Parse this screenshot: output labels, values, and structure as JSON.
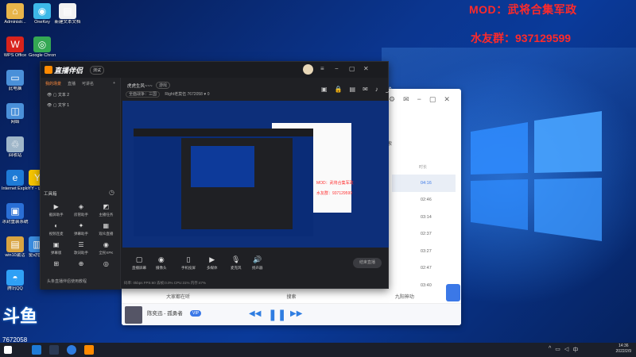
{
  "desktop": {
    "icons": [
      {
        "label": "Administr...",
        "color": "#e8b54a",
        "glyph": "⌂"
      },
      {
        "label": "OneKey",
        "color": "#3db8e8",
        "glyph": "◉"
      },
      {
        "label": "新建文本文档",
        "color": "#f2f2f2",
        "glyph": "▤"
      },
      {
        "label": "WPS Office",
        "color": "#d8231c",
        "glyph": "W"
      },
      {
        "label": "Google Chrome",
        "color": "#34a853",
        "glyph": "◎"
      },
      {
        "label": "此电脑",
        "color": "#4a90d9",
        "glyph": "▭"
      },
      {
        "label": "网络",
        "color": "#4a90d9",
        "glyph": "◫"
      },
      {
        "label": "回收站",
        "color": "#9fb6c9",
        "glyph": "♲"
      },
      {
        "label": "Internet Explorer",
        "color": "#1e7bd6",
        "glyph": "e"
      },
      {
        "label": "YY - 语音",
        "color": "#f5c400",
        "glyph": "Y"
      },
      {
        "label": "冰封重装系统",
        "color": "#2a6fd6",
        "glyph": "▣"
      },
      {
        "label": "win10激活",
        "color": "#d9a441",
        "glyph": "▤"
      },
      {
        "label": "驱动管理",
        "color": "#3b8de0",
        "glyph": "▥"
      },
      {
        "label": "腾讯QQ",
        "color": "#2fa0f5",
        "glyph": "◓"
      }
    ]
  },
  "overlay": {
    "mod_text": "MOD：武将合集军政",
    "qq_group_text": "水友群：937129599"
  },
  "live_app": {
    "app_name": "直播伴侣",
    "app_badge": "测试",
    "left_tabs": [
      "我的场景",
      "直播",
      "可讲名"
    ],
    "scenes": [
      "文本 2",
      "文字 1"
    ],
    "toolbox_title": "工具箱",
    "tools": [
      {
        "icon": "▶",
        "label": "截屏助手"
      },
      {
        "icon": "◈",
        "label": "房管助手"
      },
      {
        "icon": "◩",
        "label": "主播任务"
      },
      {
        "icon": "◐",
        "label": "视频连麦"
      },
      {
        "icon": "✦",
        "label": "弹幕助手"
      },
      {
        "icon": "▦",
        "label": "观众直播"
      },
      {
        "icon": "▣",
        "label": "弹幕版"
      },
      {
        "icon": "☰",
        "label": "歌词助手"
      },
      {
        "icon": "◉",
        "label": "全民XPK"
      },
      {
        "icon": "⊞",
        "label": ""
      },
      {
        "icon": "⊕",
        "label": ""
      },
      {
        "icon": "◎",
        "label": ""
      }
    ],
    "left_footer": "头条直播伴侣使用教程",
    "room_title": "虎虎生风~~~",
    "room_tag": "游戏",
    "room_category": "全面战争：三国",
    "room_meta": "Right老莫伍  7672058",
    "room_fans": "0",
    "preview_overlay": [
      "MOD：武将合集军政",
      "水友群：937129599"
    ],
    "controls": [
      {
        "icon": "▢",
        "label": "直播屏幕"
      },
      {
        "icon": "◉",
        "label": "摄像头"
      },
      {
        "icon": "▯",
        "label": "手机投屏"
      },
      {
        "icon": "▶",
        "label": "多媒体"
      },
      {
        "icon": "🎙",
        "label": "麦克风"
      },
      {
        "icon": "🔊",
        "label": "扬声器"
      }
    ],
    "start_button": "结束直播",
    "stats": "码率: 0kbps   FPS:60   丢帧:0.0%   CPU:31%   内存:47%"
  },
  "music_app": {
    "times": [
      "04:16",
      "02:46",
      "03:14",
      "02:37",
      "03:27",
      "02:47",
      "03:40"
    ],
    "time_header": "时长",
    "search_label": "搜索",
    "tabs": [
      "大家都在听",
      "搜索",
      "九阳神功"
    ],
    "song_title": "陈奕迅 - 孤勇者",
    "vip_badge": "VIP"
  },
  "watermark": {
    "big_text": "斗鱼",
    "room_id": "7672058"
  },
  "taskbar": {
    "time": "14:36",
    "date": "2022/2/9"
  },
  "colors": {
    "accent_red": "#ff2a2a",
    "app_orange": "#ff8a00",
    "music_blue": "#2f7de1"
  }
}
